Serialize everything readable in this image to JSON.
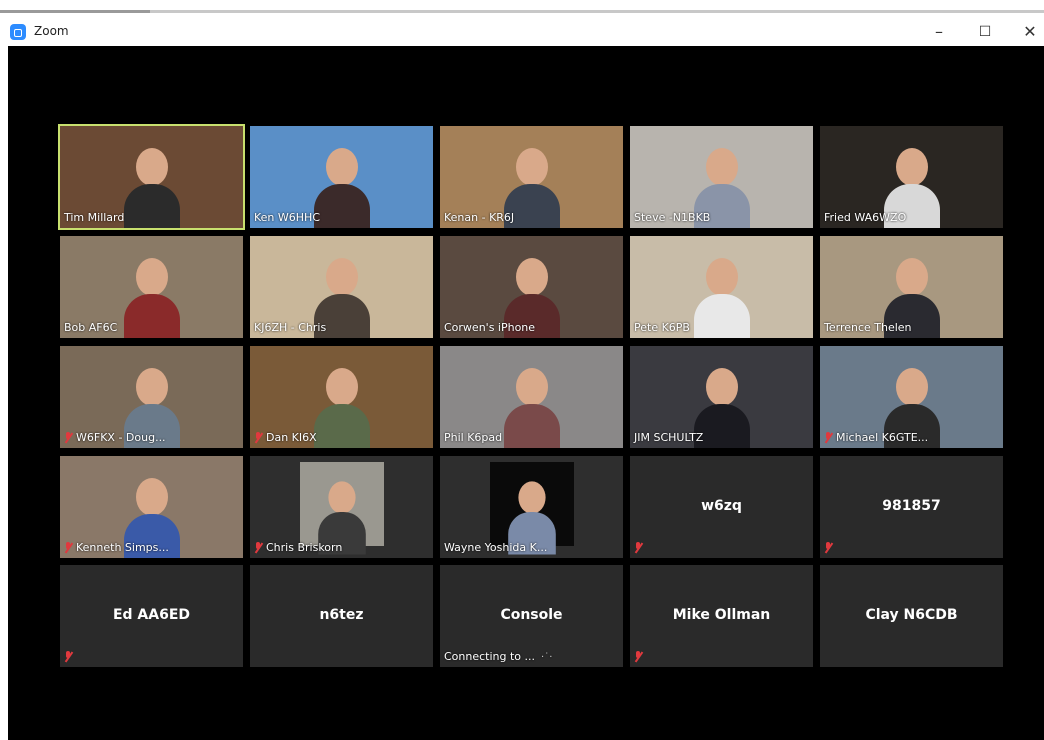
{
  "window": {
    "title": "Zoom",
    "controls": {
      "minimize": "–",
      "maximize": "☐",
      "close": "✕"
    }
  },
  "colors": {
    "stage_bg": "#000000",
    "tile_bg": "#2e2e2e",
    "active_speaker_border": "#c8e06e",
    "mute_icon": "#e0393e"
  },
  "participants": [
    {
      "name": "Tim Millard",
      "video": true,
      "muted": false,
      "active": true,
      "bg": "#6b4a34",
      "shirt": "#2b2b2b"
    },
    {
      "name": "Ken W6HHC",
      "video": true,
      "muted": false,
      "bg": "#5a8fc7",
      "shirt": "#3b2a2a"
    },
    {
      "name": "Kenan - KR6J",
      "video": true,
      "muted": false,
      "bg": "#a48058",
      "shirt": "#3a4250"
    },
    {
      "name": "Steve -N1BKB",
      "video": true,
      "muted": false,
      "bg": "#b8b4ae",
      "shirt": "#8a94a8"
    },
    {
      "name": "Fried  WA6WZO",
      "video": true,
      "muted": false,
      "bg": "#2a2622",
      "shirt": "#d8d8d8"
    },
    {
      "name": "Bob AF6C",
      "video": true,
      "muted": false,
      "bg": "#8a7a66",
      "shirt": "#8a2a2a"
    },
    {
      "name": "KJ6ZH - Chris",
      "video": true,
      "muted": false,
      "bg": "#c9b79a",
      "shirt": "#4a4038"
    },
    {
      "name": "Corwen's iPhone",
      "video": true,
      "muted": false,
      "bg": "#5a4a40",
      "shirt": "#5a2a2a"
    },
    {
      "name": "Pete K6PB",
      "video": true,
      "muted": false,
      "bg": "#c8bca8",
      "shirt": "#e8e8e8"
    },
    {
      "name": "Terrence Thelen",
      "video": true,
      "muted": false,
      "bg": "#a89880",
      "shirt": "#2a2a30"
    },
    {
      "name": "W6FKX - Doug...",
      "video": true,
      "muted": true,
      "bg": "#7a6a58",
      "shirt": "#6a7a8a"
    },
    {
      "name": "Dan KI6X",
      "video": true,
      "muted": true,
      "bg": "#7a5a38",
      "shirt": "#5a6a4a"
    },
    {
      "name": "Phil K6pad",
      "video": true,
      "muted": false,
      "bg": "#8a8888",
      "shirt": "#7a4a4a"
    },
    {
      "name": "JIM SCHULTZ",
      "video": true,
      "muted": false,
      "bg": "#3a3a40",
      "shirt": "#1a1a20"
    },
    {
      "name": "Michael K6GTE...",
      "video": true,
      "muted": true,
      "bg": "#6a7a8a",
      "shirt": "#2a2a2a"
    },
    {
      "name": "Kenneth Simps...",
      "video": true,
      "muted": true,
      "bg": "#8a7868",
      "shirt": "#3a5aa8"
    },
    {
      "name": "Chris Briskorn",
      "video": true,
      "muted": true,
      "small": true,
      "bg": "#9a9890",
      "shirt": "#3a3a3a"
    },
    {
      "name": "Wayne Yoshida K...",
      "video": true,
      "muted": false,
      "small": true,
      "bg": "#0a0a0a",
      "shirt": "#7a8aa8"
    },
    {
      "name": "w6zq",
      "video": false,
      "muted": true
    },
    {
      "name": "981857",
      "video": false,
      "muted": true
    },
    {
      "name": "Ed AA6ED",
      "video": false,
      "muted": true
    },
    {
      "name": "n6tez",
      "video": false,
      "muted": false
    },
    {
      "name": "Console",
      "video": false,
      "muted": false,
      "status": "Connecting to ..."
    },
    {
      "name": "Mike Ollman",
      "video": false,
      "muted": true
    },
    {
      "name": "Clay N6CDB",
      "video": false,
      "muted": false
    }
  ]
}
